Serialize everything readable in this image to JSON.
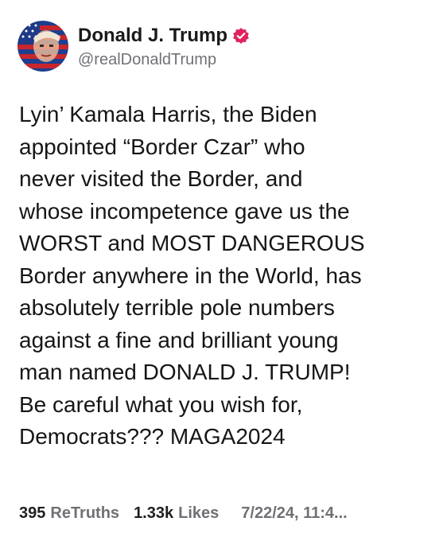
{
  "author": {
    "display_name": "Donald J. Trump",
    "handle": "@realDonaldTrump",
    "verified_icon": "verified-badge-icon",
    "verified_color": "#e0245e",
    "avatar": "avatar-image"
  },
  "post": {
    "lines": [
      "Lyin’ Kamala Harris, the Biden",
      "appointed “Border Czar” who",
      "never visited the Border, and",
      "whose incompetence gave us the",
      "WORST and MOST DANGEROUS",
      "Border anywhere in the World, has",
      "absolutely terrible pole numbers",
      "against a fine and brilliant young",
      "man named DONALD J. TRUMP!",
      "Be careful what you wish for,",
      "Democrats??? MAGA2024"
    ]
  },
  "stats": {
    "retruths_count": "395",
    "retruths_label": "ReTruths",
    "likes_count": "1.33k",
    "likes_label": "Likes",
    "timestamp": "7/22/24, 11:4..."
  }
}
